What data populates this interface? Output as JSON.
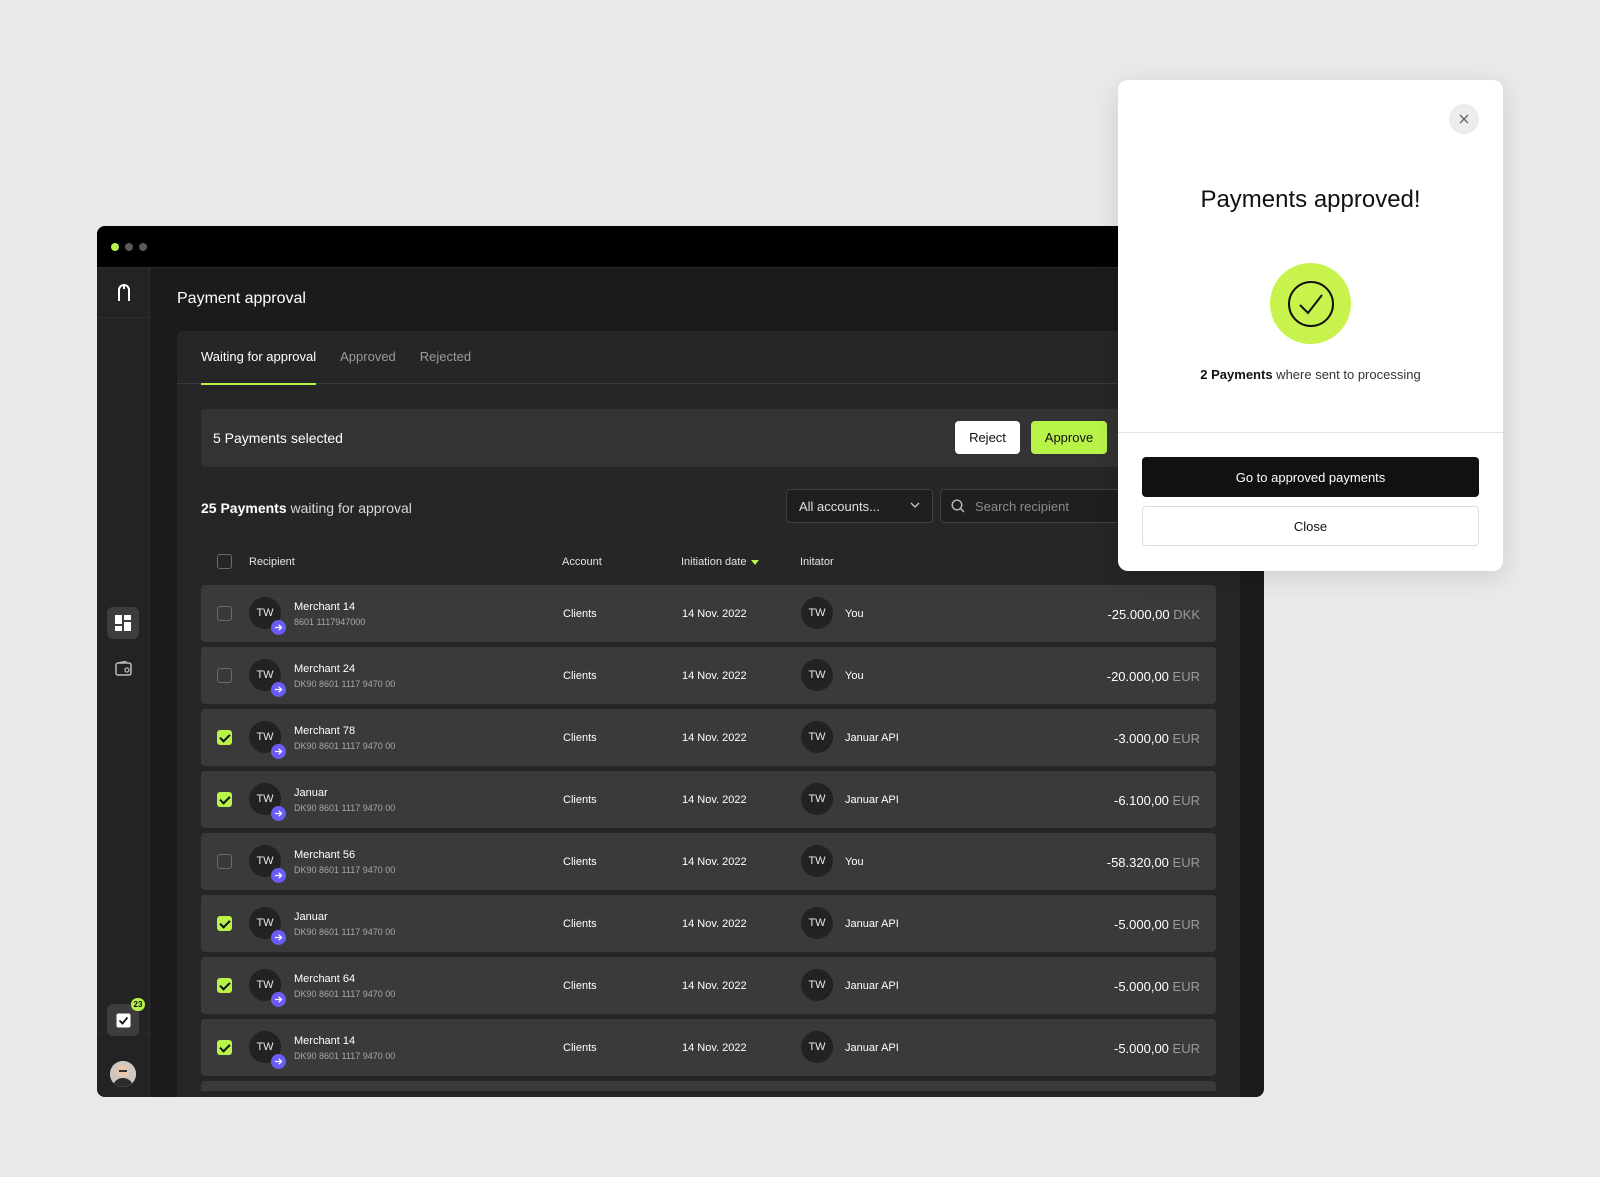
{
  "window": {
    "page_title": "Payment approval",
    "tabs": [
      {
        "label": "Waiting for approval",
        "active": true
      },
      {
        "label": "Approved",
        "active": false
      },
      {
        "label": "Rejected",
        "active": false
      }
    ]
  },
  "sidebar": {
    "notification_count": "23",
    "icons": [
      "logo-icon",
      "dashboard-icon",
      "wallet-icon",
      "tasks-icon"
    ]
  },
  "selection_bar": {
    "text": "5 Payments selected",
    "reject_label": "Reject",
    "approve_label": "Approve"
  },
  "summary": {
    "count_bold": "25 Payments",
    "count_rest": " waiting for approval"
  },
  "filters": {
    "account_value": "All accounts...",
    "search_placeholder": "Search recipient"
  },
  "table": {
    "headers": {
      "recipient": "Recipient",
      "account": "Account",
      "date": "Initiation date",
      "initiator": "Initator"
    },
    "rows": [
      {
        "checked": false,
        "avatar": "TW",
        "name": "Merchant 14",
        "acct": "8601 1117947000",
        "account": "Clients",
        "date": "14 Nov. 2022",
        "init_avatar": "TW",
        "initiator": "You",
        "amount": "-25.000,00",
        "currency": "DKK"
      },
      {
        "checked": false,
        "avatar": "TW",
        "name": "Merchant 24",
        "acct": "DK90 8601 1117 9470 00",
        "account": "Clients",
        "date": "14 Nov. 2022",
        "init_avatar": "TW",
        "initiator": "You",
        "amount": "-20.000,00",
        "currency": "EUR"
      },
      {
        "checked": true,
        "avatar": "TW",
        "name": "Merchant 78",
        "acct": "DK90 8601 1117 9470 00",
        "account": "Clients",
        "date": "14 Nov. 2022",
        "init_avatar": "TW",
        "initiator": "Januar API",
        "amount": "-3.000,00",
        "currency": "EUR"
      },
      {
        "checked": true,
        "avatar": "TW",
        "name": "Januar",
        "acct": "DK90 8601 1117 9470 00",
        "account": "Clients",
        "date": "14 Nov. 2022",
        "init_avatar": "TW",
        "initiator": "Januar API",
        "amount": "-6.100,00",
        "currency": "EUR"
      },
      {
        "checked": false,
        "avatar": "TW",
        "name": "Merchant 56",
        "acct": "DK90 8601 1117 9470 00",
        "account": "Clients",
        "date": "14 Nov. 2022",
        "init_avatar": "TW",
        "initiator": "You",
        "amount": "-58.320,00",
        "currency": "EUR"
      },
      {
        "checked": true,
        "avatar": "TW",
        "name": "Januar",
        "acct": "DK90 8601 1117 9470 00",
        "account": "Clients",
        "date": "14 Nov. 2022",
        "init_avatar": "TW",
        "initiator": "Januar API",
        "amount": "-5.000,00",
        "currency": "EUR"
      },
      {
        "checked": true,
        "avatar": "TW",
        "name": "Merchant 64",
        "acct": "DK90 8601 1117 9470 00",
        "account": "Clients",
        "date": "14 Nov. 2022",
        "init_avatar": "TW",
        "initiator": "Januar API",
        "amount": "-5.000,00",
        "currency": "EUR"
      },
      {
        "checked": true,
        "avatar": "TW",
        "name": "Merchant 14",
        "acct": "DK90 8601 1117 9470 00",
        "account": "Clients",
        "date": "14 Nov. 2022",
        "init_avatar": "TW",
        "initiator": "Januar API",
        "amount": "-5.000,00",
        "currency": "EUR"
      }
    ]
  },
  "modal": {
    "title": "Payments approved!",
    "text_bold": "2 Payments",
    "text_rest": " where sent to processing",
    "primary_label": "Go to approved payments",
    "secondary_label": "Close"
  },
  "colors": {
    "accent": "#b8f34a",
    "badge_purple": "#6a5cf5",
    "success_circle": "#c8f34d"
  }
}
